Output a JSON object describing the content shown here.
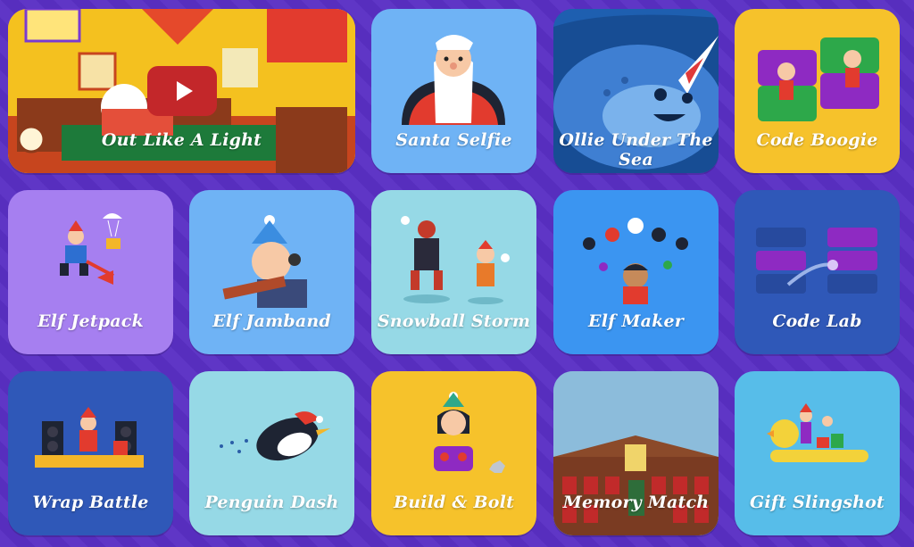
{
  "tiles": [
    {
      "key": "out-like-a-light",
      "label": "Out Like A Light",
      "color": "#f4c11f"
    },
    {
      "key": "santa-selfie",
      "label": "Santa Selfie",
      "color": "#6fb3f5"
    },
    {
      "key": "ollie-under-the-sea",
      "label": "Ollie Under The Sea",
      "color": "#1e5fb0"
    },
    {
      "key": "code-boogie",
      "label": "Code Boogie",
      "color": "#f6c22b"
    },
    {
      "key": "elf-jetpack",
      "label": "Elf Jetpack",
      "color": "#a67ff0"
    },
    {
      "key": "elf-jamband",
      "label": "Elf Jamband",
      "color": "#6fb3f5"
    },
    {
      "key": "snowball-storm",
      "label": "Snowball Storm",
      "color": "#96d9e6"
    },
    {
      "key": "elf-maker",
      "label": "Elf Maker",
      "color": "#3b95f1"
    },
    {
      "key": "code-lab",
      "label": "Code Lab",
      "color": "#2f58b8"
    },
    {
      "key": "wrap-battle",
      "label": "Wrap Battle",
      "color": "#2f58b8"
    },
    {
      "key": "penguin-dash",
      "label": "Penguin Dash",
      "color": "#96d9e6"
    },
    {
      "key": "build-and-bolt",
      "label": "Build & Bolt",
      "color": "#f6c22b"
    },
    {
      "key": "memory-match",
      "label": "Memory Match",
      "color": "#6fa9d0"
    },
    {
      "key": "gift-slingshot",
      "label": "Gift Slingshot",
      "color": "#57bde9"
    }
  ]
}
